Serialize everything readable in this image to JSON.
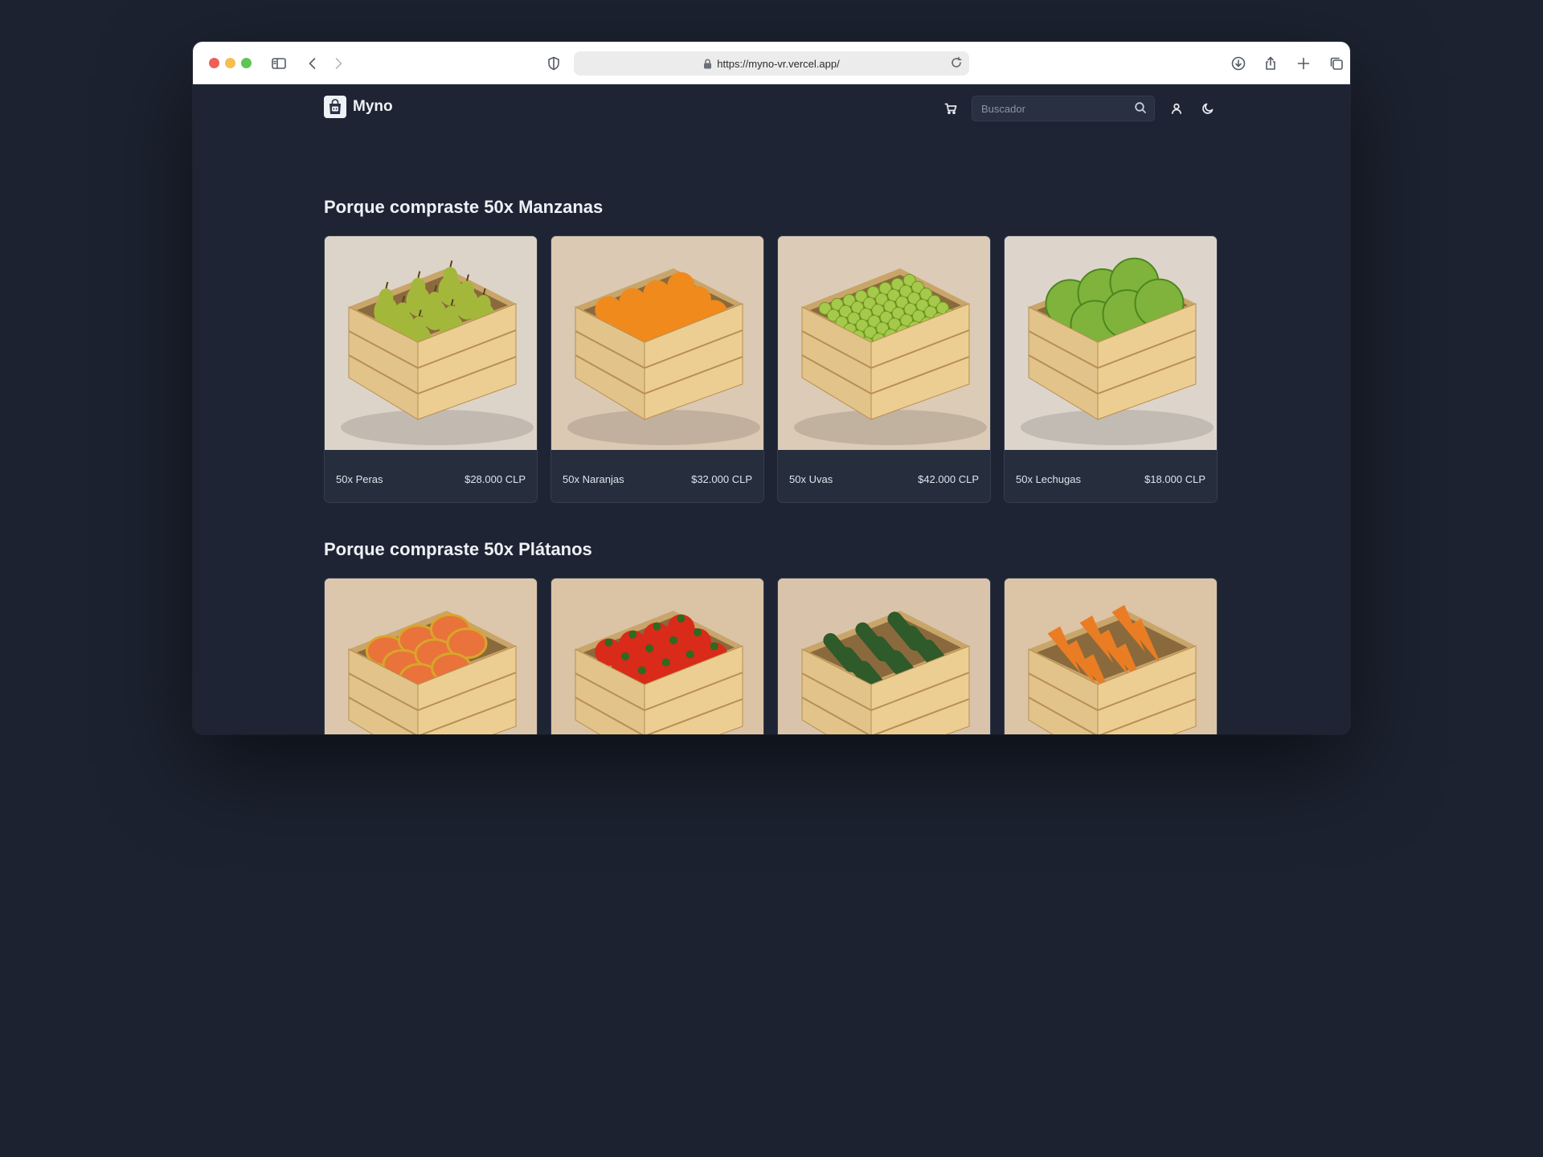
{
  "browser": {
    "url": "https://myno-vr.vercel.app/"
  },
  "nav": {
    "brand": "Myno",
    "search_placeholder": "Buscador",
    "icons": [
      "cart-icon",
      "search-icon",
      "user-icon",
      "moon-icon"
    ]
  },
  "sections": [
    {
      "title": "Porque compraste 50x Manzanas",
      "products": [
        {
          "name": "50x Peras",
          "price": "$28.000 CLP",
          "image": "pears-crate"
        },
        {
          "name": "50x Naranjas",
          "price": "$32.000 CLP",
          "image": "oranges-crate"
        },
        {
          "name": "50x Uvas",
          "price": "$42.000 CLP",
          "image": "grapes-crate"
        },
        {
          "name": "50x Lechugas",
          "price": "$18.000 CLP",
          "image": "lettuce-crate"
        }
      ]
    },
    {
      "title": "Porque compraste 50x Plátanos",
      "products": [
        {
          "name": "",
          "price": "",
          "image": "mangoes-crate"
        },
        {
          "name": "",
          "price": "",
          "image": "tomatoes-crate"
        },
        {
          "name": "",
          "price": "",
          "image": "cucumbers-crate"
        },
        {
          "name": "",
          "price": "",
          "image": "carrots-crate"
        }
      ]
    }
  ],
  "colors": {
    "page_bg": "#1e2433",
    "outer_bg": "#1c2230",
    "card_bg": "#262e3d",
    "text": "#eef1f6"
  }
}
